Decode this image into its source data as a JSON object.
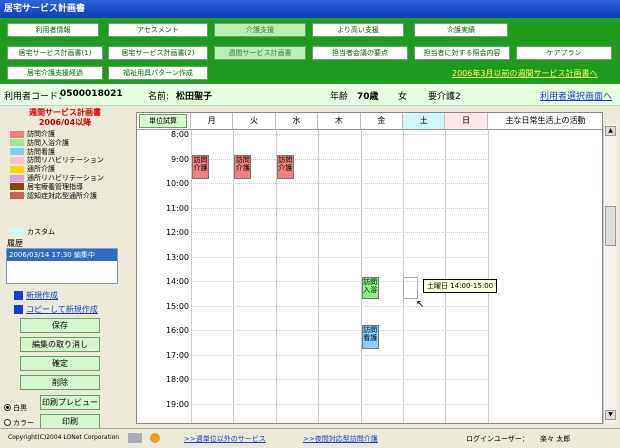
{
  "window_title": "居宅サービス計画書",
  "tabs_row1": [
    "利用者情報",
    "アセスメント",
    "介護支援",
    "より高い支援",
    "介護実績"
  ],
  "tabs_row2": [
    "居宅サービス計画書(1)",
    "居宅サービス計画書(2)",
    "週間サービス計画書",
    "担当者会議の要点",
    "担当者に対する照会内容",
    "ケアプラン"
  ],
  "tabs_row3": [
    "居宅介護支援経過",
    "福祉用具パターン作成"
  ],
  "tabs_link": "2006年3月以前の週間サービス計画書へ",
  "info": {
    "user_code_label": "利用者コード：",
    "user_code": "0500018021",
    "name_label": "名前:",
    "name": "松田聖子",
    "age_label": "年齢",
    "age": "70歳",
    "gender": "女",
    "care_level": "要介護2",
    "select_link": "利用者選択画面へ"
  },
  "left": {
    "title1": "週間サービス計画書",
    "title2": "2006/04以降",
    "legend": [
      {
        "label": "訪問介護",
        "color": "#f08080"
      },
      {
        "label": "訪問入浴介護",
        "color": "#90ee90"
      },
      {
        "label": "訪問看護",
        "color": "#87cefa"
      },
      {
        "label": "訪問リハビリテーション",
        "color": "#ffc0cb"
      },
      {
        "label": "通所介護",
        "color": "#ffd700"
      },
      {
        "label": "通所リハビリテーション",
        "color": "#dda0dd"
      },
      {
        "label": "居宅療養管理指導",
        "color": "#8b4513"
      },
      {
        "label": "認知症対応型通所介護",
        "color": "#cd5c5c"
      },
      {
        "label": "カスタム",
        "color": "#cdf8f8"
      }
    ],
    "history_label": "履歴",
    "history_item": "2006/03/14 17:30 編集中",
    "new_link": "新規作成",
    "copy_link": "コピーして新規作成",
    "buttons": [
      "保存",
      "編集の取り消し",
      "確定",
      "削除",
      "印刷プレビュー",
      "印刷"
    ],
    "radio1": "白黒",
    "radio2": "カラー"
  },
  "grid": {
    "calc_button": "単位試算",
    "days": [
      "月",
      "火",
      "水",
      "木",
      "金",
      "土",
      "日"
    ],
    "activities_header": "主な日常生活上の活動",
    "times": [
      "8:00",
      "9:00",
      "10:00",
      "11:00",
      "12:00",
      "13:00",
      "14:00",
      "15:00",
      "16:00",
      "17:00",
      "18:00",
      "19:00"
    ],
    "events": [
      {
        "day": 0,
        "text": "訪問介護",
        "color": "#f08080"
      },
      {
        "day": 1,
        "text": "訪問介護",
        "color": "#f08080"
      },
      {
        "day": 2,
        "text": "訪問介護",
        "color": "#f08080"
      },
      {
        "day": 4,
        "text": "訪問入浴",
        "color": "#90ee90"
      },
      {
        "day": 4,
        "text": "訪問看護",
        "color": "#87cefa"
      }
    ],
    "tooltip": "土曜日 14:00-15:00"
  },
  "status": {
    "link1": ">>週単位以外のサービス",
    "link2": ">>夜間対応型訪問介護",
    "login_label": "ログインユーザー：",
    "login_user": "楽々 太郎",
    "copyright": "Copyright(C)2004 LONet Corporation"
  }
}
